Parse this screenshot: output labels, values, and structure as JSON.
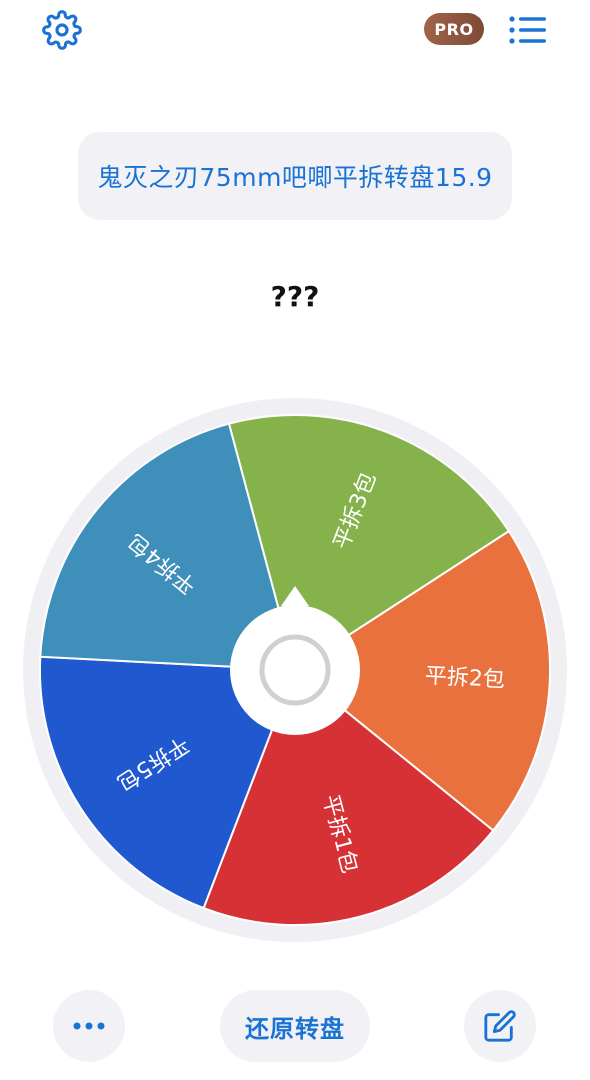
{
  "header": {
    "settings_icon": "gear-icon",
    "pro_label": "PRO",
    "menu_icon": "list-icon"
  },
  "title": "鬼灭之刃75mm吧唧平拆转盘15.9",
  "result": "???",
  "wheel": {
    "segments": [
      {
        "label": "平拆3包",
        "color": "#86b24c"
      },
      {
        "label": "平拆2包",
        "color": "#e8713d"
      },
      {
        "label": "平拆1包",
        "color": "#d63236"
      },
      {
        "label": "平拆5包",
        "color": "#2058cf"
      },
      {
        "label": "平拆4包",
        "color": "#3f8fbb"
      }
    ]
  },
  "footer": {
    "more_icon": "more-dots-icon",
    "reset_label": "还原转盘",
    "edit_icon": "edit-icon"
  },
  "colors": {
    "accent": "#1a73d4",
    "panel_bg": "#f2f2f6"
  }
}
